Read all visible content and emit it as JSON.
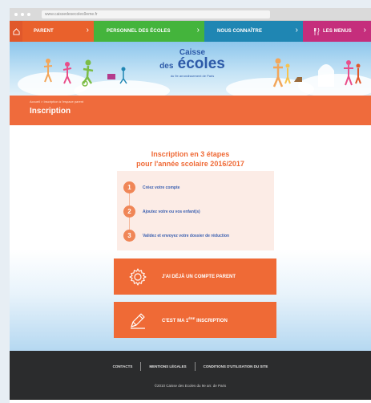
{
  "browser": {
    "url": "www.caissedesecoles9eme.fr"
  },
  "nav": {
    "items": [
      {
        "label": "Parent",
        "color": "#e9612c"
      },
      {
        "label": "Personnel des écoles",
        "color": "#44b43c"
      },
      {
        "label": "Nous connaître",
        "color": "#1f86b3"
      },
      {
        "label": "Les menus",
        "color": "#c52e7c"
      }
    ],
    "home_icon": "home-icon",
    "chevron_glyph": "›",
    "fork_glyph": "🍴"
  },
  "banner": {
    "logo_top": "Caisse",
    "logo_des": "des",
    "logo_main": "écoles",
    "logo_sub": "du 9e arrondissement de Paris"
  },
  "header": {
    "breadcrumb": "Accueil > Inscription à l'espace parent",
    "title": "Inscription"
  },
  "main": {
    "heading_line1": "Inscription en 3 étapes",
    "heading_line2": "pour l'année scolaire 2016/2017",
    "steps": [
      {
        "number": "1",
        "text": "Créez votre compte"
      },
      {
        "number": "2",
        "text": "Ajoutez votre ou vos enfant(s)"
      },
      {
        "number": "3",
        "text": "Validez et envoyez votre dossier de réduction"
      }
    ],
    "existing_account_button": "J'ai déjà un compte parent",
    "first_registration_prefix": "C'est ma 1",
    "first_registration_sup": "ère",
    "first_registration_suffix": " inscription"
  },
  "footer": {
    "links": [
      "Contacts",
      "Mentions légales",
      "Conditions d'utilisation du site"
    ],
    "copyright": "©2010 Caisse des Ecoles du 9e arr. de Paris"
  },
  "colors": {
    "accent_orange": "#ef6a36",
    "link_blue": "#3a5fb0",
    "footer_bg": "#2b2c2d"
  }
}
